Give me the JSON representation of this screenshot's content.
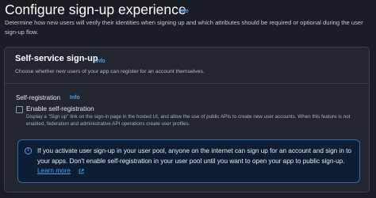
{
  "page": {
    "title": "Configure sign-up experience",
    "info": "Info",
    "description": "Determine how new users will verify their identities when signing up and which attributes should be required or optional during the user sign-up flow."
  },
  "card": {
    "title": "Self-service sign-up",
    "info": "Info",
    "description": "Choose whether new users of your app can register for an account themselves.",
    "section": {
      "label": "Self-registration",
      "info": "Info",
      "checkbox": {
        "label": "Enable self-registration",
        "checked": false,
        "description": "Display a \"Sign up\" link on the sign-in page in the hosted UI, and allow the use of public APIs to create new user accounts. When this feature is not enabled, federation and administrative API operations create user profiles."
      }
    },
    "alert": {
      "icon": "info-circle-icon",
      "icon_glyph": "i",
      "text": "If you activate user sign-up in your user pool, anyone on the internet can sign up for an account and sign in to your apps. Don't enable self-registration in your user pool until you want to open your app to public sign-up.",
      "link": "Learn more"
    }
  },
  "colors": {
    "background": "#1a1d23",
    "card": "#212630",
    "link": "#539fe5",
    "alert_background": "#0d1e34",
    "alert_border": "#2f6bab"
  }
}
